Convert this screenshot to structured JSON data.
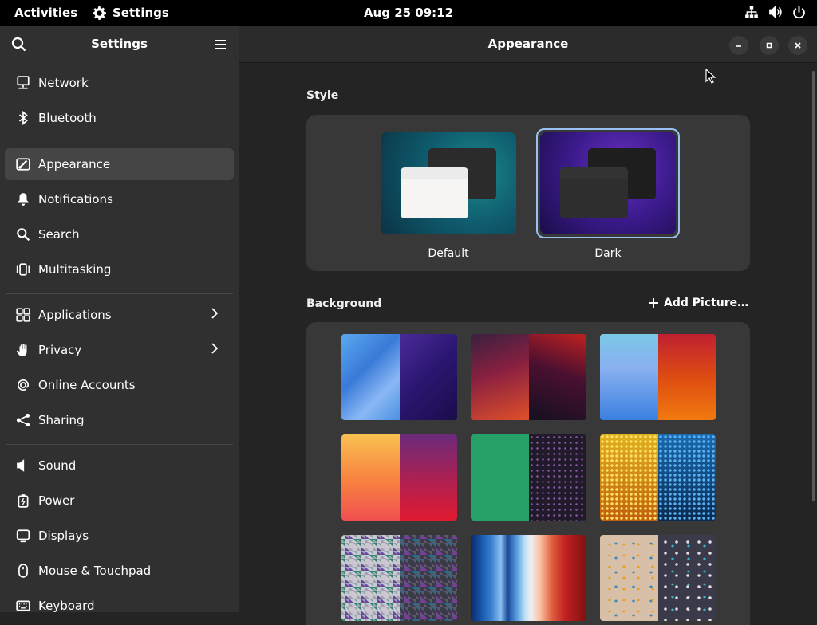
{
  "topbar": {
    "activities": "Activities",
    "app_name": "Settings",
    "clock": "Aug 25  09:12"
  },
  "sidebar": {
    "title": "Settings",
    "items": [
      {
        "label": "Network",
        "icon": "network-icon"
      },
      {
        "label": "Bluetooth",
        "icon": "bluetooth-icon"
      },
      {
        "label": "Appearance",
        "icon": "appearance-icon",
        "active": true
      },
      {
        "label": "Notifications",
        "icon": "bell-icon"
      },
      {
        "label": "Search",
        "icon": "search-icon"
      },
      {
        "label": "Multitasking",
        "icon": "multitasking-icon"
      },
      {
        "label": "Applications",
        "icon": "applications-icon",
        "submenu": true
      },
      {
        "label": "Privacy",
        "icon": "hand-icon",
        "submenu": true
      },
      {
        "label": "Online Accounts",
        "icon": "at-icon"
      },
      {
        "label": "Sharing",
        "icon": "share-icon"
      },
      {
        "label": "Sound",
        "icon": "speaker-icon"
      },
      {
        "label": "Power",
        "icon": "battery-icon"
      },
      {
        "label": "Displays",
        "icon": "display-icon"
      },
      {
        "label": "Mouse & Touchpad",
        "icon": "mouse-icon"
      },
      {
        "label": "Keyboard",
        "icon": "keyboard-icon"
      }
    ]
  },
  "main": {
    "title": "Appearance",
    "style": {
      "label": "Style",
      "options": [
        {
          "label": "Default",
          "selected": false
        },
        {
          "label": "Dark",
          "selected": true
        }
      ]
    },
    "background": {
      "label": "Background",
      "add_picture": "Add Picture…"
    }
  },
  "colors": {
    "accent": "#99c1f1",
    "sidebar_bg": "#303030",
    "content_bg": "#242424",
    "card_bg": "#383838"
  }
}
